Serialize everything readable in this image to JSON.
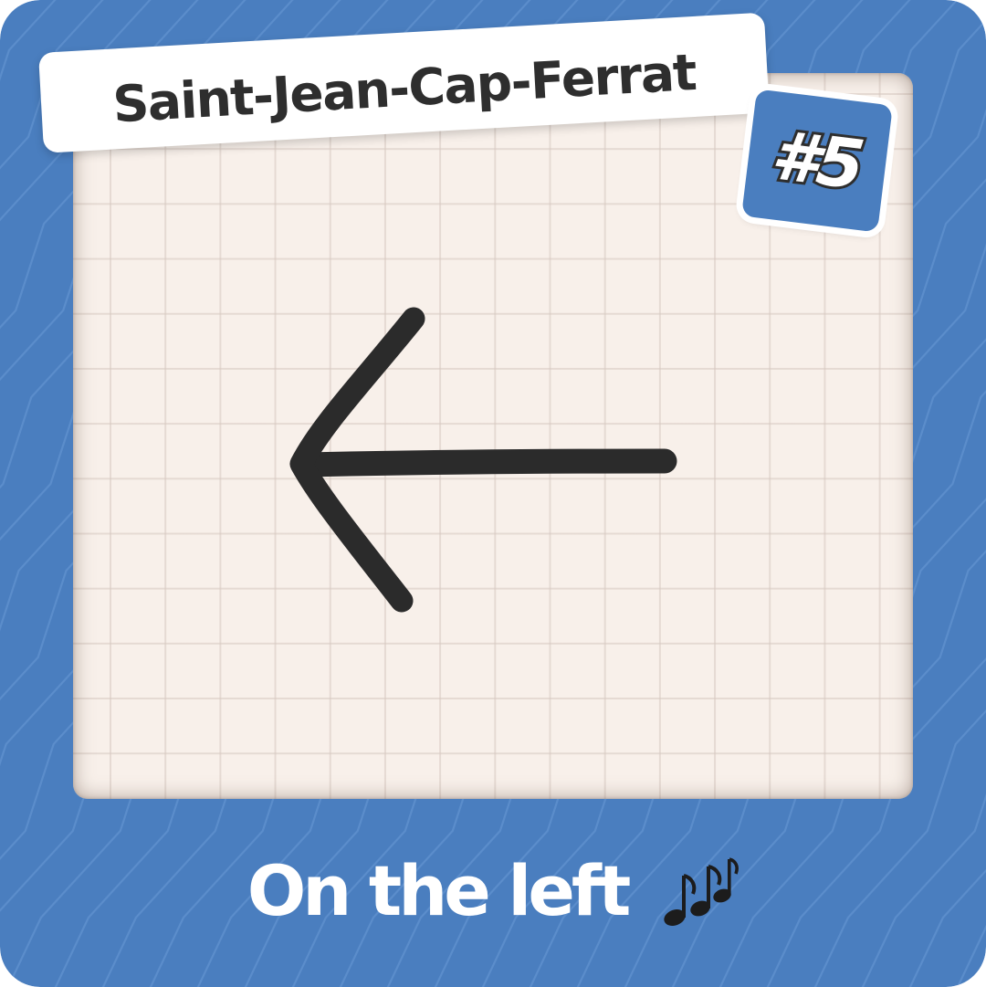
{
  "card": {
    "location_label": "Saint-Jean-Cap-Ferrat",
    "number_label": "#5",
    "caption": "On the left",
    "caption_icon": "music-notes-icon",
    "direction_icon": "left-arrow-icon"
  },
  "colors": {
    "background_blue": "#4a7ebf",
    "paper": "#f8f0ea",
    "ink": "#2e2e2e",
    "white": "#ffffff"
  }
}
